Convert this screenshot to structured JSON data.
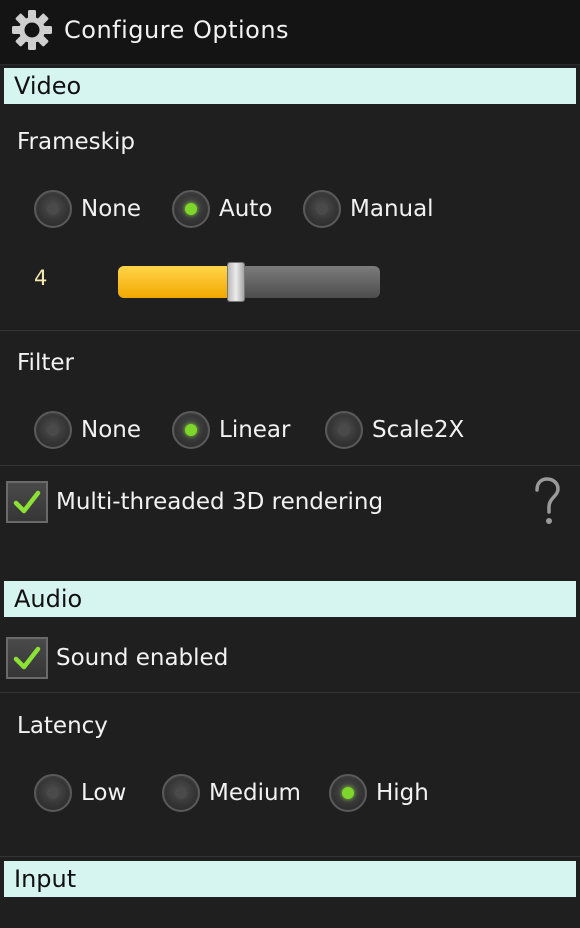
{
  "header": {
    "title": "Configure Options",
    "icon": "gear-icon"
  },
  "video": {
    "section_label": "Video",
    "frameskip": {
      "label": "Frameskip",
      "options": [
        "None",
        "Auto",
        "Manual"
      ],
      "selected": "Auto",
      "value": "4",
      "slider_fraction": 0.45
    },
    "filter": {
      "label": "Filter",
      "options": [
        "None",
        "Linear",
        "Scale2X"
      ],
      "selected": "Linear"
    },
    "multithreaded": {
      "label": "Multi-threaded 3D rendering",
      "checked": true,
      "help_icon": "question-mark-icon"
    }
  },
  "audio": {
    "section_label": "Audio",
    "sound": {
      "label": "Sound enabled",
      "checked": true
    },
    "latency": {
      "label": "Latency",
      "options": [
        "Low",
        "Medium",
        "High"
      ],
      "selected": "High"
    }
  },
  "input": {
    "section_label": "Input"
  },
  "colors": {
    "section_header_bg": "#d6f5f1",
    "radio_selected": "#7ed62b",
    "slider_fill": "#f1a800",
    "checkmark": "#8be234"
  }
}
